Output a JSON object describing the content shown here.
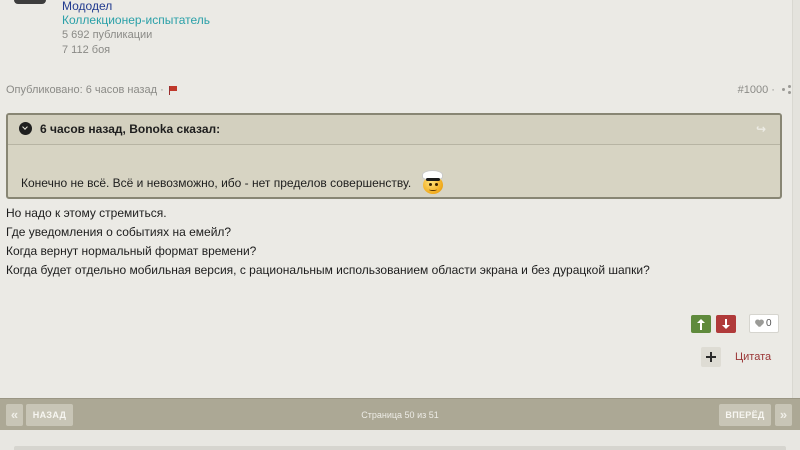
{
  "author": {
    "name": "Мододел",
    "rank": "Коллекционер-испытатель",
    "posts": "5 692 публикации",
    "battles": "7 112 боя"
  },
  "meta": {
    "published": "Опубликовано: 6 часов назад ·",
    "post_number": "#1000 ·"
  },
  "quote": {
    "header": "6 часов назад, Bonoka сказал:",
    "text": "Конечно не всё. Всё и невозможно, ибо - нет пределов совершенству."
  },
  "post": {
    "lines": [
      "Но надо к этому стремиться.",
      "Где уведомления о событиях на емейл?",
      "Когда вернут нормальный формат времени?",
      "Когда будет отдельно мобильная версия, с рациональным использованием области экрана и без дурацкой шапки?"
    ]
  },
  "reactions": {
    "like_count": "0",
    "quote_label": "Цитата"
  },
  "pagination": {
    "first": "«",
    "prev": "НАЗАД",
    "page_label": "Страница 50 из 51",
    "next": "ВПЕРЁД",
    "last": "»"
  },
  "colors": {
    "accent_up": "#5f8a3c",
    "accent_down": "#b03a3a",
    "pager_bar": "#aca895",
    "quote_border": "#888674"
  }
}
